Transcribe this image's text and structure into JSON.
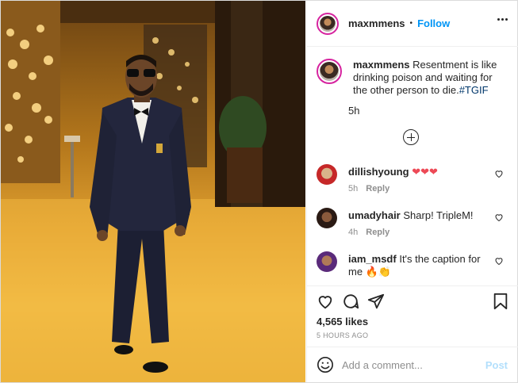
{
  "post": {
    "username": "maxmmens",
    "separator": "•",
    "follow_label": "Follow",
    "more_icon": "more-options-icon"
  },
  "caption": {
    "username": "maxmmens",
    "text": "Resentment is like drinking poison and waiting for the other person to die.",
    "hashtag": "#TGIF",
    "time": "5h"
  },
  "load_more_icon": "plus-circle-icon",
  "comments": [
    {
      "username": "dillishyoung",
      "text": "❤❤❤",
      "time": "5h",
      "reply_label": "Reply"
    },
    {
      "username": "umadyhair",
      "text": "Sharp! TripleM!",
      "time": "4h",
      "reply_label": "Reply"
    },
    {
      "username": "iam_msdf",
      "text": "It's the caption for me 🔥👏",
      "time": "",
      "reply_label": ""
    }
  ],
  "actions": {
    "like_icon": "heart-icon",
    "comment_icon": "comment-icon",
    "share_icon": "share-icon",
    "save_icon": "bookmark-icon"
  },
  "likes": "4,565 likes",
  "time_ago": "5 HOURS AGO",
  "add_comment": {
    "emoji_icon": "emoji-icon",
    "placeholder": "Add a comment...",
    "post_label": "Post"
  },
  "colors": {
    "link_blue": "#0095f6",
    "post_disabled": "#b2dffc",
    "hashtag": "#00376b",
    "heart_red": "#ed4956"
  }
}
